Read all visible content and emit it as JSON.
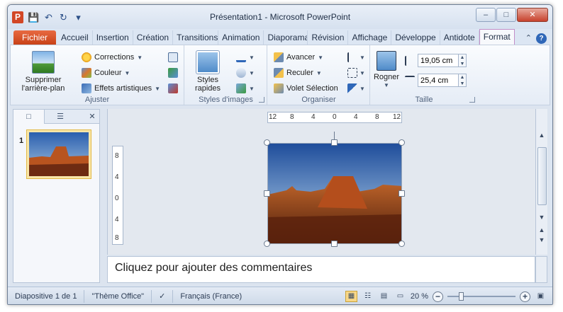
{
  "window": {
    "title": "Présentation1 - Microsoft PowerPoint"
  },
  "app_icon": "P",
  "qat": [
    "save-icon",
    "undo-icon",
    "redo-icon",
    "customize-icon"
  ],
  "tabs": [
    {
      "label": "Fichier"
    },
    {
      "label": "Accueil"
    },
    {
      "label": "Insertion"
    },
    {
      "label": "Création"
    },
    {
      "label": "Transitions"
    },
    {
      "label": "Animation"
    },
    {
      "label": "Diaporama"
    },
    {
      "label": "Révision"
    },
    {
      "label": "Affichage"
    },
    {
      "label": "Développe"
    },
    {
      "label": "Antidote"
    },
    {
      "label": "Format"
    }
  ],
  "ribbon": {
    "ajuster": {
      "label": "Ajuster",
      "remove_bg": "Supprimer l'arrière-plan",
      "corrections": "Corrections",
      "couleur": "Couleur",
      "effets": "Effets artistiques"
    },
    "styles": {
      "label": "Styles d'images",
      "rapides": "Styles rapides"
    },
    "organiser": {
      "label": "Organiser",
      "avancer": "Avancer",
      "reculer": "Reculer",
      "volet": "Volet Sélection"
    },
    "taille": {
      "label": "Taille",
      "rogner": "Rogner",
      "height": "19,05 cm",
      "width": "25,4 cm"
    }
  },
  "panel": {
    "slide_number": "1"
  },
  "rulers": {
    "horizontal": [
      "12",
      "8",
      "4",
      "0",
      "4",
      "8",
      "12"
    ],
    "vertical": [
      "8",
      "4",
      "0",
      "4",
      "8"
    ]
  },
  "notes": {
    "placeholder": "Cliquez pour ajouter des commentaires"
  },
  "status": {
    "slide": "Diapositive 1 de 1",
    "theme": "\"Thème Office\"",
    "language": "Français (France)",
    "zoom": "20 %",
    "zoom_fraction": 0.2
  },
  "colors": {
    "accent": "#c84218",
    "format_tab_border": "#c38ec8"
  }
}
